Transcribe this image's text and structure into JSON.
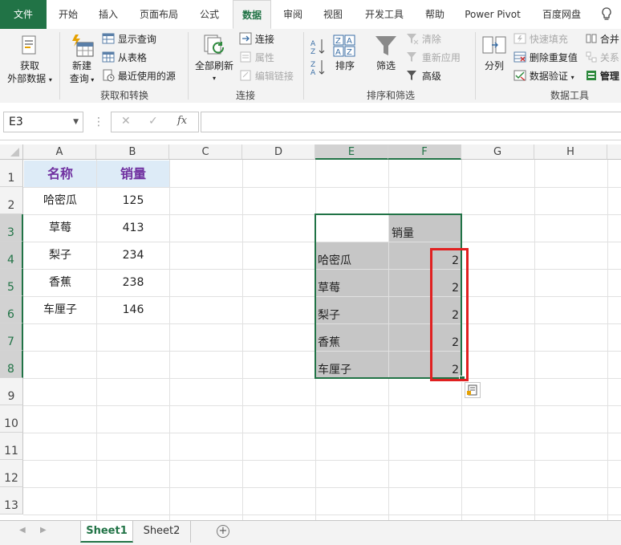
{
  "ribbon": {
    "tabs": [
      "文件",
      "开始",
      "插入",
      "页面布局",
      "公式",
      "数据",
      "审阅",
      "视图",
      "开发工具",
      "帮助",
      "Power Pivot",
      "百度网盘"
    ],
    "active_tab": "数据",
    "groups": {
      "get_transform": {
        "label": "获取和转换",
        "get_external_line1": "获取",
        "get_external_line2": "外部数据",
        "new_query_line1": "新建",
        "new_query_line2": "查询",
        "show_queries": "显示查询",
        "from_table": "从表格",
        "recent_sources": "最近使用的源"
      },
      "connections": {
        "label": "连接",
        "refresh_all": "全部刷新",
        "connections": "连接",
        "properties": "属性",
        "edit_links": "编辑链接"
      },
      "sort_filter": {
        "label": "排序和筛选",
        "sort": "排序",
        "filter": "筛选",
        "clear": "清除",
        "reapply": "重新应用",
        "advanced": "高级"
      },
      "data_tools": {
        "label": "数据工具",
        "text_to_columns": "分列",
        "flash_fill": "快速填充",
        "remove_duplicates": "删除重复值",
        "data_validation": "数据验证",
        "consolidate": "合并",
        "relationships": "关系",
        "manage": "管理"
      }
    }
  },
  "formula_bar": {
    "name_box": "E3",
    "fx": "fx",
    "formula": ""
  },
  "sheet": {
    "columns": [
      "A",
      "B",
      "C",
      "D",
      "E",
      "F",
      "G",
      "H"
    ],
    "rows": [
      "1",
      "2",
      "3",
      "4",
      "5",
      "6",
      "7",
      "8",
      "9",
      "10",
      "11",
      "12",
      "13"
    ],
    "source_table": {
      "header_name": "名称",
      "header_sales": "销量",
      "rows": [
        {
          "name": "哈密瓜",
          "sales": "125"
        },
        {
          "name": "草莓",
          "sales": "413"
        },
        {
          "name": "梨子",
          "sales": "234"
        },
        {
          "name": "香蕉",
          "sales": "238"
        },
        {
          "name": "车厘子",
          "sales": "146"
        }
      ]
    },
    "pivot_table": {
      "header_sales": "销量",
      "rows": [
        {
          "name": "哈密瓜",
          "value": "2"
        },
        {
          "name": "草莓",
          "value": "2"
        },
        {
          "name": "梨子",
          "value": "2"
        },
        {
          "name": "香蕉",
          "value": "2"
        },
        {
          "name": "车厘子",
          "value": "2"
        }
      ]
    }
  },
  "sheet_tabs": [
    "Sheet1",
    "Sheet2"
  ],
  "active_sheet": "Sheet1",
  "colors": {
    "excel_green": "#217346",
    "header_fill": "#ddebf7",
    "header_text": "#7030a0",
    "pivot_fill": "#c6c6c6",
    "highlight_red": "#e02020"
  }
}
